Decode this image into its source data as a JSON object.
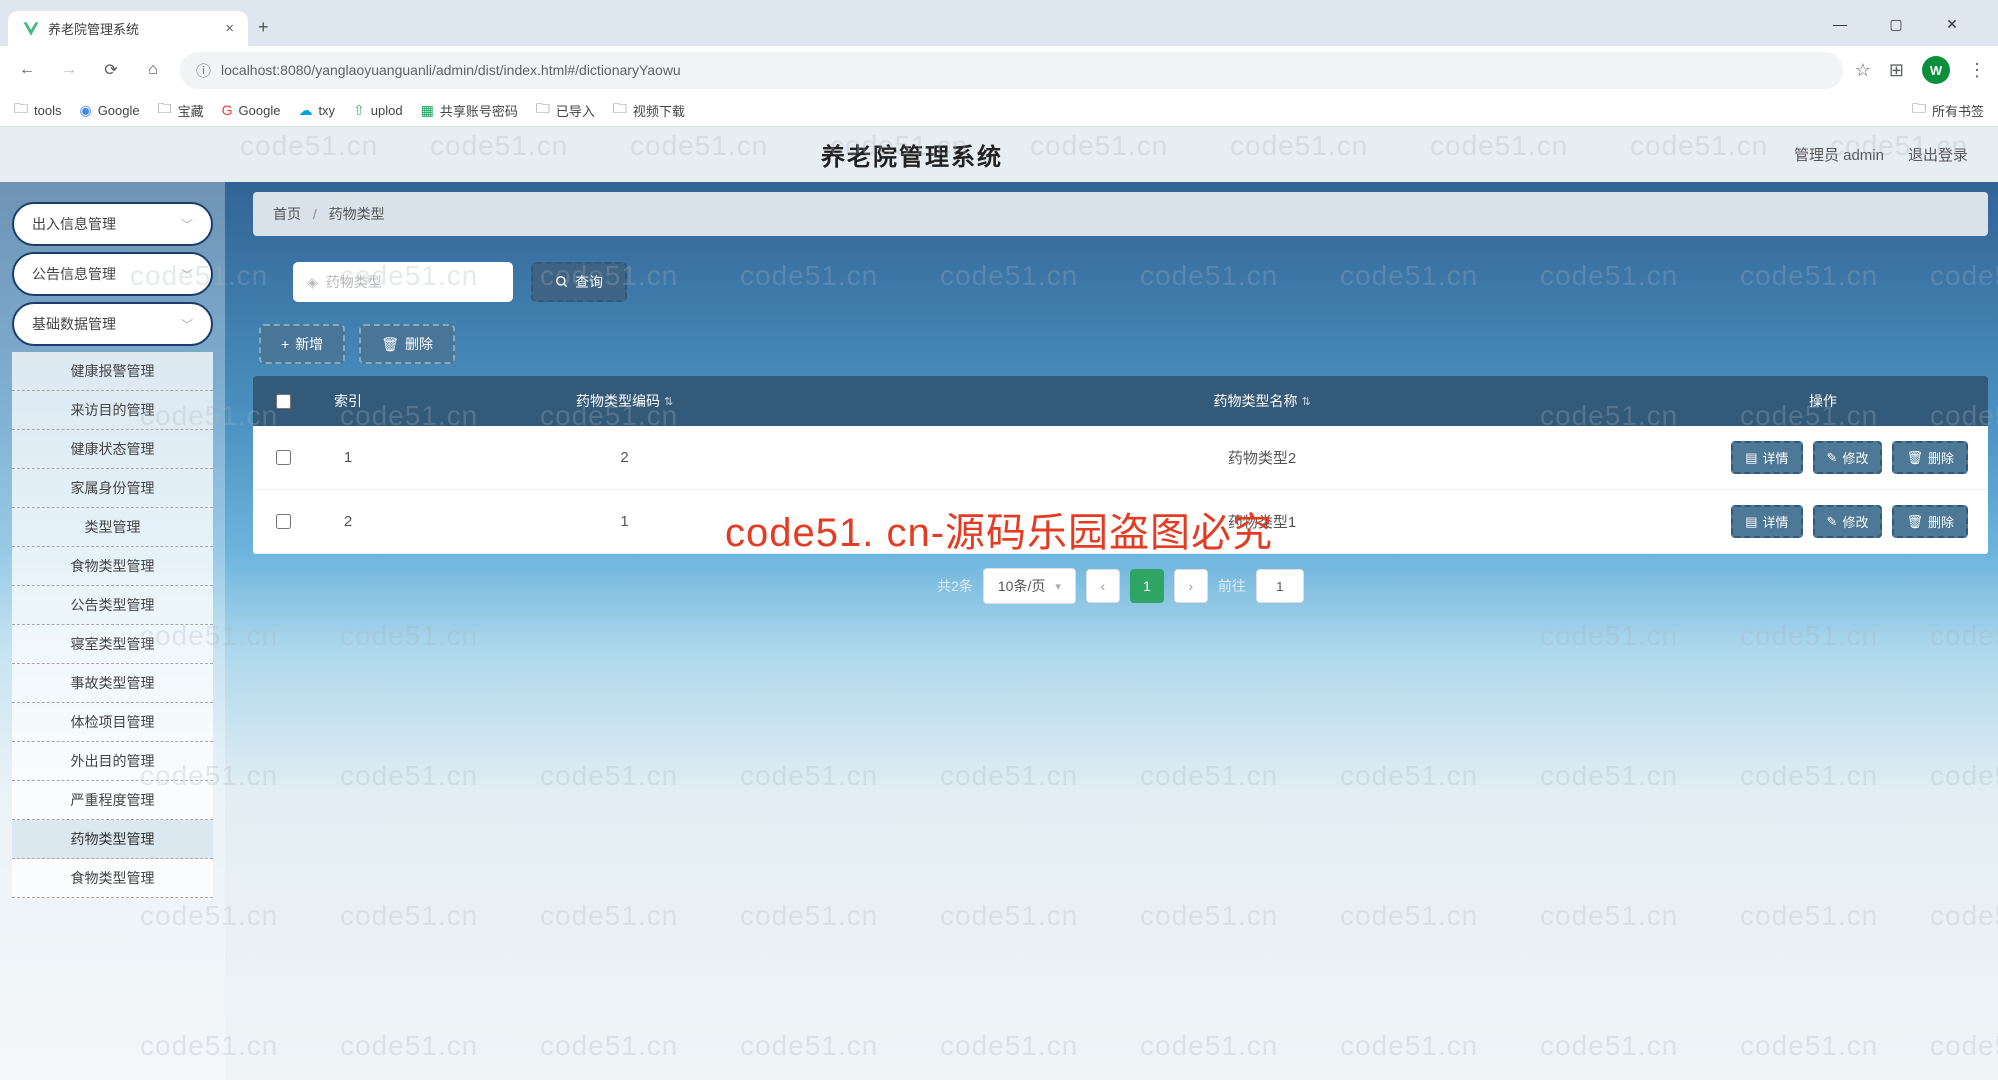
{
  "browser": {
    "tab_title": "养老院管理系统",
    "new_tab": "+",
    "url": "localhost:8080/yanglaoyuanguanli/admin/dist/index.html#/dictionaryYaowu",
    "avatar_letter": "W",
    "bookmarks": [
      "tools",
      "Google",
      "宝藏",
      "Google",
      "txy",
      "uplod",
      "共享账号密码",
      "已导入",
      "视频下载"
    ],
    "all_bookmarks": "所有书签"
  },
  "header": {
    "title": "养老院管理系统",
    "user_label": "管理员 admin",
    "logout": "退出登录"
  },
  "sidebar": {
    "caps": [
      "出入信息管理",
      "公告信息管理",
      "基础数据管理"
    ],
    "items": [
      "健康报警管理",
      "来访目的管理",
      "健康状态管理",
      "家属身份管理",
      "类型管理",
      "食物类型管理",
      "公告类型管理",
      "寝室类型管理",
      "事故类型管理",
      "体检项目管理",
      "外出目的管理",
      "严重程度管理",
      "药物类型管理",
      "食物类型管理"
    ],
    "active_index": 12
  },
  "breadcrumb": {
    "home": "首页",
    "sep": "/",
    "current": "药物类型"
  },
  "search": {
    "placeholder": "药物类型",
    "query_label": "查询"
  },
  "actions": {
    "add": "新增",
    "delete": "删除"
  },
  "table": {
    "headers": {
      "index": "索引",
      "code": "药物类型编码",
      "name": "药物类型名称",
      "ops": "操作"
    },
    "op_labels": {
      "detail": "详情",
      "edit": "修改",
      "del": "删除"
    },
    "rows": [
      {
        "idx": "1",
        "code": "2",
        "name": "药物类型2"
      },
      {
        "idx": "2",
        "code": "1",
        "name": "药物类型1"
      }
    ]
  },
  "pager": {
    "total_label": "共2条",
    "per_page": "10条/页",
    "current": "1",
    "goto_label": "前往",
    "goto_value": "1"
  },
  "watermark_text": "code51.cn",
  "watermark_big": "code51. cn-源码乐园盗图必究"
}
